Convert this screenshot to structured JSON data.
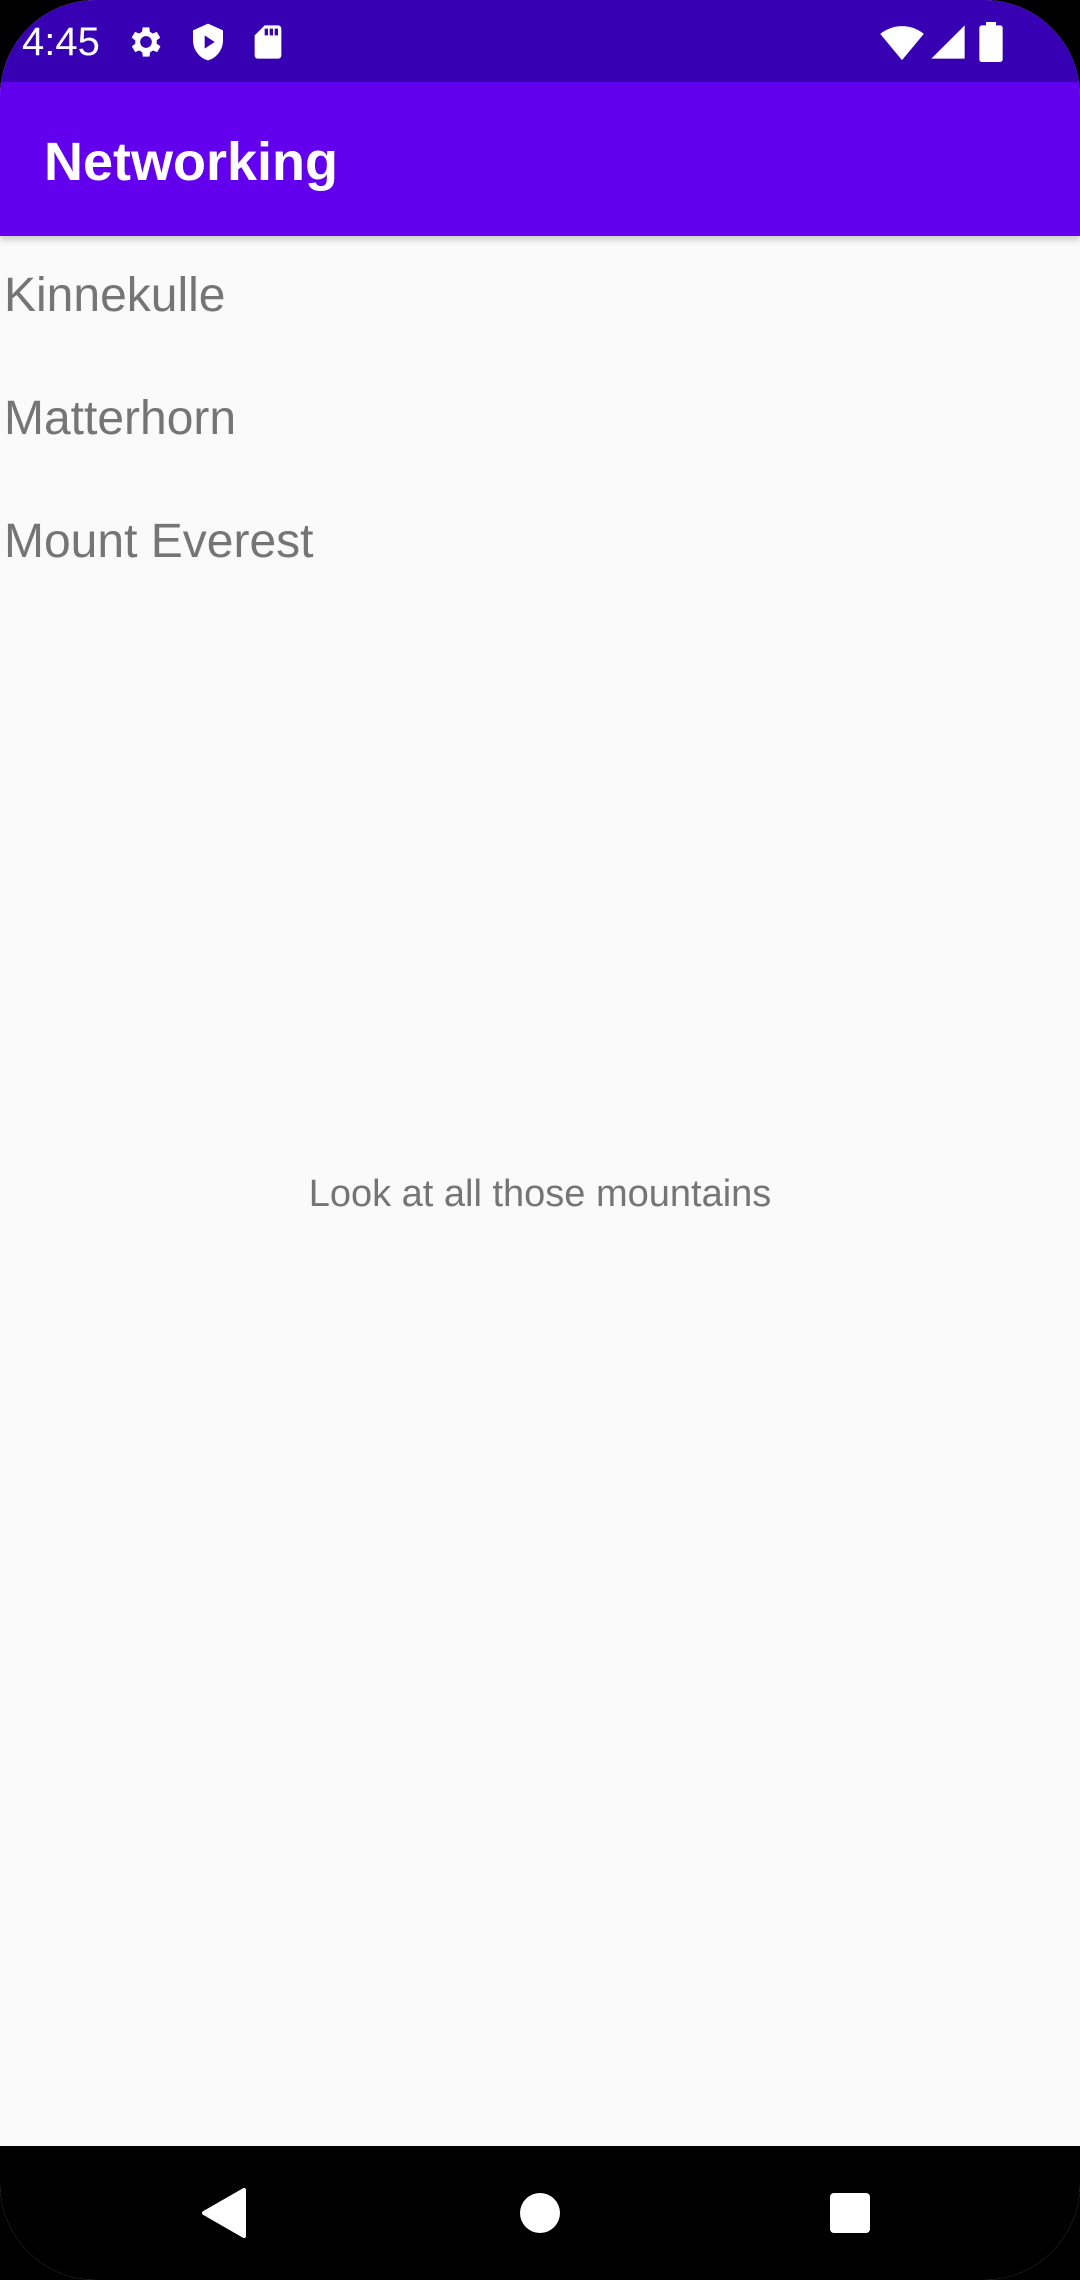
{
  "status_bar": {
    "time": "4:45",
    "left_icons": [
      "gear-icon",
      "shield-icon",
      "sd-card-icon"
    ],
    "right_icons": [
      "wifi-icon",
      "cellular-signal-icon",
      "battery-icon"
    ]
  },
  "app_bar": {
    "title": "Networking"
  },
  "mountains": [
    {
      "name": "Kinnekulle"
    },
    {
      "name": "Matterhorn"
    },
    {
      "name": "Mount Everest"
    }
  ],
  "message": "Look at all those mountains",
  "nav_bar": {
    "buttons": [
      "back-icon",
      "home-icon",
      "recents-icon"
    ]
  },
  "colors": {
    "status_bar": "#3700b3",
    "app_bar": "#6200ee",
    "background": "#fafafa",
    "text_secondary": "#757575"
  }
}
